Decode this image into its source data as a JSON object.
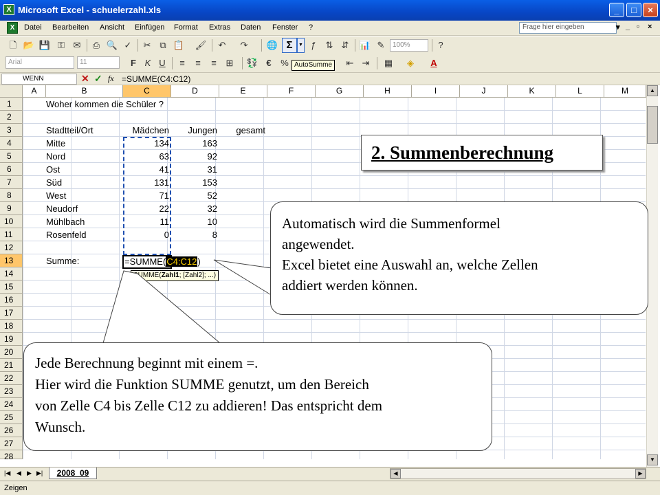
{
  "window": {
    "title": "Microsoft Excel - schuelerzahl.xls",
    "buttons": [
      "_",
      "□",
      "×"
    ]
  },
  "menu": {
    "items": [
      "Datei",
      "Bearbeiten",
      "Ansicht",
      "Einfügen",
      "Format",
      "Extras",
      "Daten",
      "Fenster",
      "?"
    ],
    "help_placeholder": "Frage hier eingeben",
    "mdi_buttons": [
      "▾",
      "_",
      "▫",
      "×"
    ]
  },
  "toolbar": {
    "zoom": "100%",
    "font_name": "Arial",
    "font_size": "11",
    "tooltip": "AutoSumme",
    "sigma": "Σ",
    "icons": [
      "new-icon",
      "open-icon",
      "save-icon",
      "print-icon",
      "cut-icon",
      "copy-icon",
      "paste-icon",
      "undo-icon",
      "redo-icon",
      "autosum-icon",
      "sort-icon",
      "chart-icon",
      "help-icon",
      "bold-icon",
      "italic-icon",
      "underline-icon",
      "align-icon",
      "euro-icon",
      "percent-icon",
      "border-icon",
      "fill-color-icon",
      "font-color-icon"
    ]
  },
  "formula_bar": {
    "name_box": "WENN",
    "cancel": "✕",
    "ok": "✓",
    "fx": "fx",
    "formula": "=SUMME(C4:C12)"
  },
  "grid": {
    "columns": [
      "A",
      "B",
      "C",
      "D",
      "E",
      "F",
      "G",
      "H",
      "I",
      "J",
      "K",
      "L",
      "M"
    ],
    "active_column": "C",
    "rows": [
      "1",
      "2",
      "3",
      "4",
      "5",
      "6",
      "7",
      "8",
      "9",
      "10",
      "11",
      "12",
      "13",
      "14",
      "15",
      "16",
      "17",
      "18",
      "19",
      "20",
      "21",
      "22",
      "23",
      "24",
      "25",
      "26",
      "27",
      "28"
    ],
    "active_row": "13",
    "title_cell": "Woher kommen die Schüler ?",
    "headers": [
      "Stadtteil/Ort",
      "Mädchen",
      "Jungen",
      "gesamt"
    ],
    "data_rows": [
      {
        "ort": "Mitte",
        "maedchen": "134",
        "jungen": "163"
      },
      {
        "ort": "Nord",
        "maedchen": "63",
        "jungen": "92"
      },
      {
        "ort": "Ost",
        "maedchen": "41",
        "jungen": "31"
      },
      {
        "ort": "Süd",
        "maedchen": "131",
        "jungen": "153"
      },
      {
        "ort": "West",
        "maedchen": "71",
        "jungen": "52"
      },
      {
        "ort": "Neudorf",
        "maedchen": "22",
        "jungen": "32"
      },
      {
        "ort": "Mühlbach",
        "maedchen": "11",
        "jungen": "10"
      },
      {
        "ort": "Rosenfeld",
        "maedchen": "0",
        "jungen": "8"
      }
    ],
    "summe_label": "Summe:",
    "edit_formula_prefix": "=SUMME(",
    "edit_formula_range": "C4:C12",
    "edit_formula_suffix": ")",
    "arg_tip_fn": "SUMME(",
    "arg_tip_bold": "Zahl1",
    "arg_tip_rest": "; [Zahl2]; ...)"
  },
  "sheet": {
    "tab": "2008_09",
    "status": "Zeigen"
  },
  "callouts": {
    "heading": "2. Summenberechnung",
    "right_lines": [
      "Automatisch wird die Summenformel",
      "angewendet.",
      "Excel bietet eine Auswahl an, welche Zellen",
      "addiert werden können."
    ],
    "left_lines": [
      "Jede Berechnung beginnt mit einem =.",
      "Hier wird die Funktion SUMME genutzt, um den Bereich",
      "von Zelle C4 bis Zelle C12 zu addieren! Das entspricht dem",
      "Wunsch."
    ]
  }
}
